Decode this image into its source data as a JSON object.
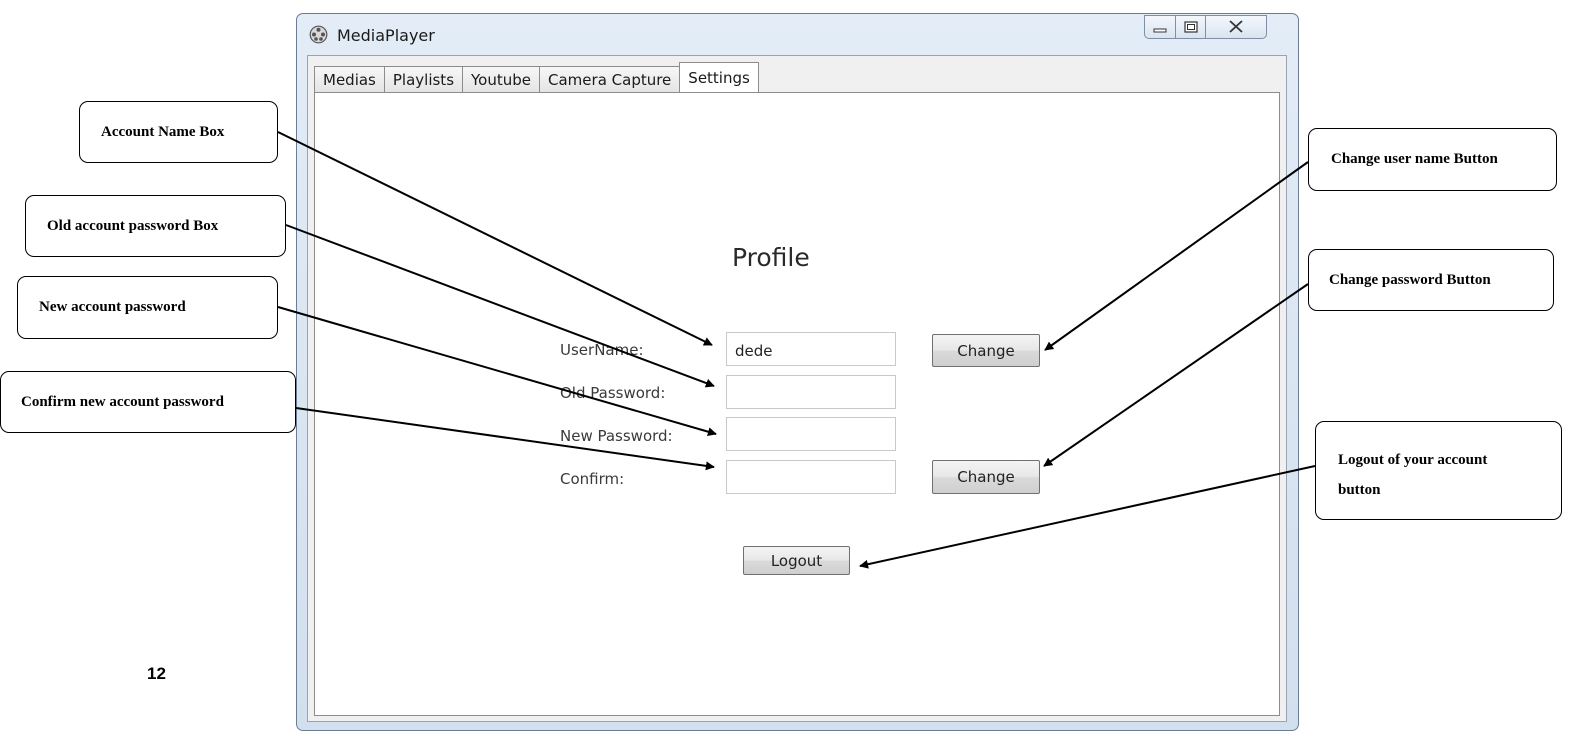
{
  "window": {
    "title": "MediaPlayer",
    "app_icon": "media-player-icon",
    "controls": [
      "minimize-icon",
      "maximize-icon",
      "close-icon"
    ]
  },
  "tabs": [
    {
      "label": "Medias",
      "active": false
    },
    {
      "label": "Playlists",
      "active": false
    },
    {
      "label": "Youtube",
      "active": false
    },
    {
      "label": "Camera Capture",
      "active": false
    },
    {
      "label": "Settings",
      "active": true
    }
  ],
  "profile": {
    "title": "Profile",
    "username_label": "UserName:",
    "username_value": "dede",
    "old_password_label": "Old Password:",
    "old_password_value": "",
    "new_password_label": "New Password:",
    "new_password_value": "",
    "confirm_label": "Confirm:",
    "confirm_value": "",
    "change_username_button": "Change",
    "change_password_button": "Change",
    "logout_button": "Logout"
  },
  "annotations": {
    "account_name_box": "Account Name  Box",
    "old_password_box": "Old account password  Box",
    "new_password": "New account password",
    "confirm_new_password": "Confirm new account password",
    "change_user_name_button": "Change user name Button",
    "change_password_button": "Change  password Button",
    "logout_line1": "Logout of your account",
    "logout_line2": "button"
  },
  "page_number": "12"
}
